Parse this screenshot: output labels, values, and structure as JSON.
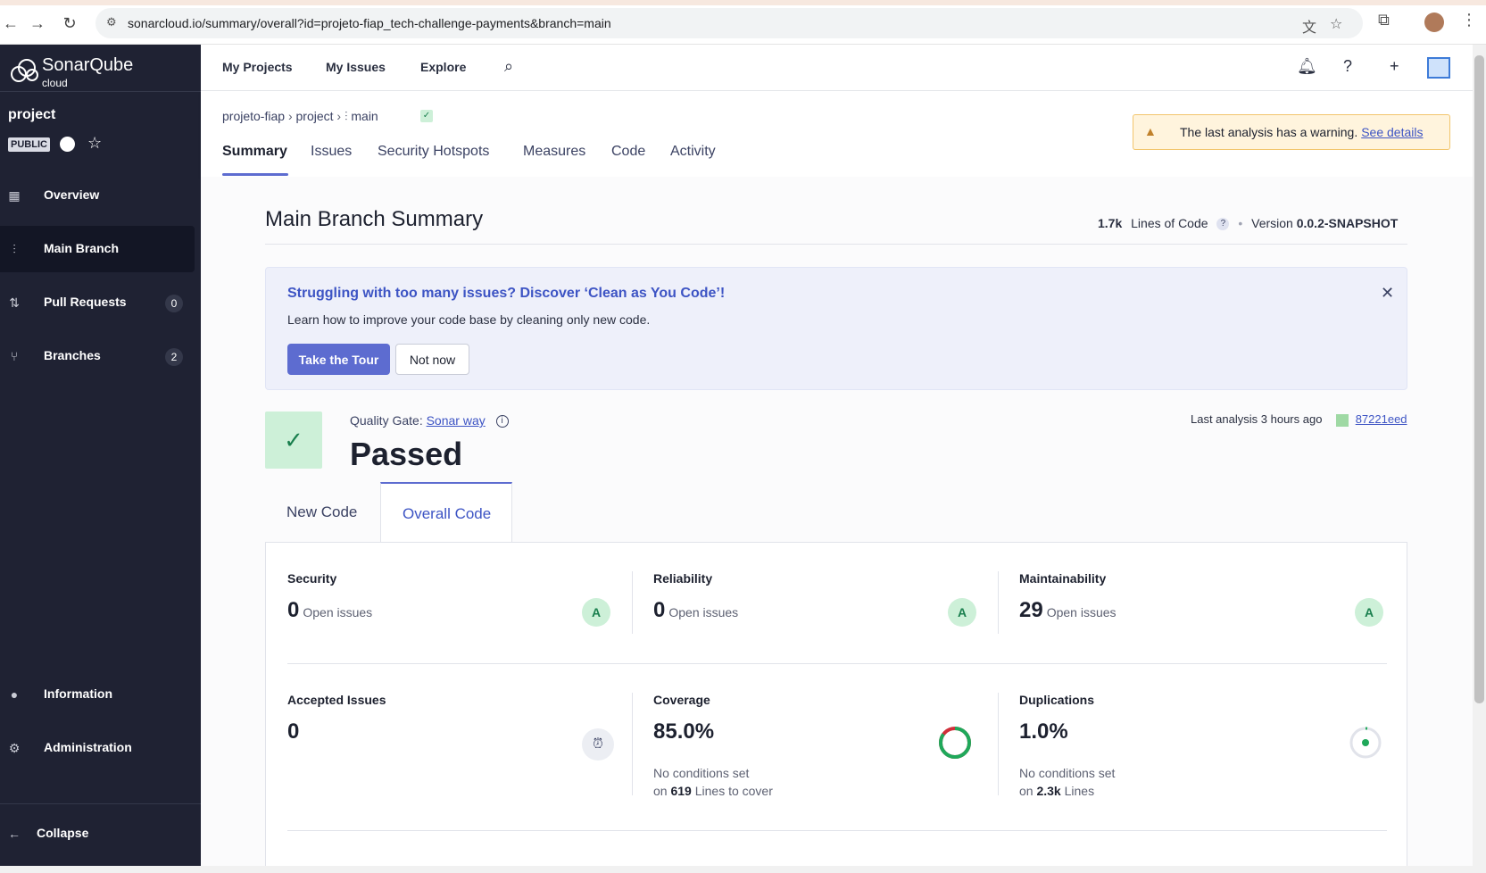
{
  "browser": {
    "url": "sonarcloud.io/summary/overall?id=projeto-fiap_tech-challenge-payments&branch=main"
  },
  "logo": {
    "name": "SonarQube",
    "sub": "cloud"
  },
  "project": {
    "name": "project",
    "visibility": "PUBLIC"
  },
  "sidebar": {
    "items": [
      {
        "label": "Overview",
        "icon": "overview-icon"
      },
      {
        "label": "Main Branch",
        "icon": "branch-icon"
      },
      {
        "label": "Pull Requests",
        "icon": "pull-request-icon",
        "count": "0"
      },
      {
        "label": "Branches",
        "icon": "branches-icon",
        "count": "2"
      }
    ],
    "bottom": [
      {
        "label": "Information",
        "icon": "info-icon"
      },
      {
        "label": "Administration",
        "icon": "gear-icon"
      }
    ],
    "collapse": "Collapse"
  },
  "topnav": {
    "links": [
      "My Projects",
      "My Issues",
      "Explore"
    ]
  },
  "breadcrumb": {
    "org": "projeto-fiap",
    "project": "project",
    "branch": "main"
  },
  "tabs": [
    "Summary",
    "Issues",
    "Security Hotspots",
    "Measures",
    "Code",
    "Activity"
  ],
  "warning": {
    "text": "The last analysis has a warning.",
    "link": "See details"
  },
  "summary": {
    "title": "Main Branch Summary",
    "loc_value": "1.7k",
    "loc_label": "Lines of Code",
    "version_label": "Version",
    "version": "0.0.2-SNAPSHOT"
  },
  "promo": {
    "title": "Struggling with too many issues? Discover ‘Clean as You Code’!",
    "text": "Learn how to improve your code base by cleaning only new code.",
    "primary": "Take the Tour",
    "secondary": "Not now"
  },
  "quality_gate": {
    "label": "Quality Gate:",
    "name": "Sonar way",
    "status": "Passed",
    "last_analysis": "Last analysis 3 hours ago",
    "commit": "87221eed"
  },
  "code_tabs": {
    "new": "New Code",
    "overall": "Overall Code"
  },
  "measures": {
    "security": {
      "title": "Security",
      "value": "0",
      "unit": "Open issues",
      "rating": "A"
    },
    "reliability": {
      "title": "Reliability",
      "value": "0",
      "unit": "Open issues",
      "rating": "A"
    },
    "maintainability": {
      "title": "Maintainability",
      "value": "29",
      "unit": "Open issues",
      "rating": "A"
    },
    "accepted": {
      "title": "Accepted Issues",
      "value": "0"
    },
    "coverage": {
      "title": "Coverage",
      "value": "85.0%",
      "sub1": "No conditions set",
      "sub2_pre": "on",
      "sub2_val": "619",
      "sub2_post": "Lines to cover",
      "fraction": 0.85
    },
    "duplications": {
      "title": "Duplications",
      "value": "1.0%",
      "sub1": "No conditions set",
      "sub2_pre": "on",
      "sub2_val": "2.3k",
      "sub2_post": "Lines",
      "fraction": 0.01
    }
  },
  "colors": {
    "accent": "#5d6cd0",
    "sidebar": "#1f2233",
    "pass": "#1a7f4e"
  }
}
